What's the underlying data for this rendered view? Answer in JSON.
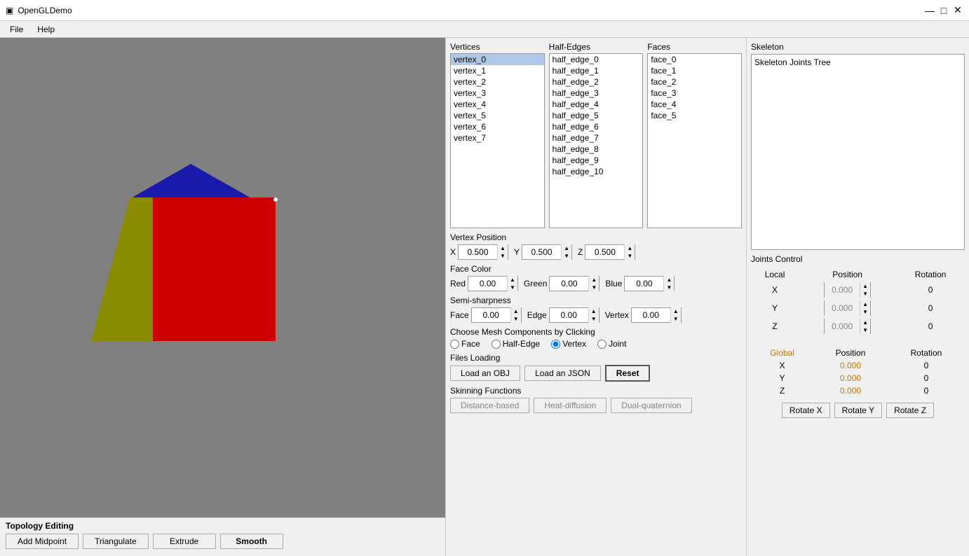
{
  "app": {
    "title": "OpenGLDemo",
    "icon": "▣"
  },
  "titlebar": {
    "minimize": "—",
    "maximize": "□",
    "close": "✕"
  },
  "menu": {
    "items": [
      "File",
      "Help"
    ]
  },
  "vertices": {
    "label": "Vertices",
    "items": [
      "vertex_0",
      "vertex_1",
      "vertex_2",
      "vertex_3",
      "vertex_4",
      "vertex_5",
      "vertex_6",
      "vertex_7"
    ],
    "selected": "vertex_0"
  },
  "half_edges": {
    "label": "Half-Edges",
    "items": [
      "half_edge_0",
      "half_edge_1",
      "half_edge_2",
      "half_edge_3",
      "half_edge_4",
      "half_edge_5",
      "half_edge_6",
      "half_edge_7",
      "half_edge_8",
      "half_edge_9",
      "half_edge_10"
    ]
  },
  "faces": {
    "label": "Faces",
    "items": [
      "face_0",
      "face_1",
      "face_2",
      "face_3",
      "face_4",
      "face_5"
    ]
  },
  "skeleton": {
    "label": "Skeleton",
    "content": "Skeleton Joints Tree"
  },
  "vertex_position": {
    "label": "Vertex Position",
    "x_label": "X",
    "y_label": "Y",
    "z_label": "Z",
    "x_value": "0.500",
    "y_value": "0.500",
    "z_value": "0.500"
  },
  "face_color": {
    "label": "Face Color",
    "red_label": "Red",
    "green_label": "Green",
    "blue_label": "Blue",
    "red_value": "0.00",
    "green_value": "0.00",
    "blue_value": "0.00"
  },
  "semi_sharpness": {
    "label": "Semi-sharpness",
    "face_label": "Face",
    "edge_label": "Edge",
    "vertex_label": "Vertex",
    "face_value": "0.00",
    "edge_value": "0.00",
    "vertex_value": "0.00"
  },
  "mesh_components": {
    "label": "Choose Mesh Components by Clicking",
    "options": [
      "Face",
      "Half-Edge",
      "Vertex",
      "Joint"
    ],
    "selected": "Vertex"
  },
  "files_loading": {
    "label": "Files Loading",
    "load_obj": "Load an OBJ",
    "load_json": "Load an JSON",
    "reset": "Reset"
  },
  "skinning": {
    "label": "Skinning Functions",
    "buttons": [
      "Distance-based",
      "Heat-diffusion",
      "Dual-quaternion"
    ]
  },
  "topology": {
    "label": "Topology Editing",
    "buttons": [
      "Add Midpoint",
      "Triangulate",
      "Extrude",
      "Smooth"
    ]
  },
  "joints_control": {
    "label": "Joints Control",
    "local_label": "Local",
    "position_label": "Position",
    "rotation_label": "Rotation",
    "global_label": "Global",
    "rows_local": [
      {
        "axis": "X",
        "position": "0.000",
        "rotation": "0"
      },
      {
        "axis": "Y",
        "position": "0.000",
        "rotation": "0"
      },
      {
        "axis": "Z",
        "position": "0.000",
        "rotation": "0"
      }
    ],
    "rows_global": [
      {
        "axis": "X",
        "position": "0.000",
        "rotation": "0"
      },
      {
        "axis": "Y",
        "position": "0.000",
        "rotation": "0"
      },
      {
        "axis": "Z",
        "position": "0.000",
        "rotation": "0"
      }
    ],
    "rotate_x": "Rotate X",
    "rotate_y": "Rotate Y",
    "rotate_z": "Rotate Z"
  }
}
